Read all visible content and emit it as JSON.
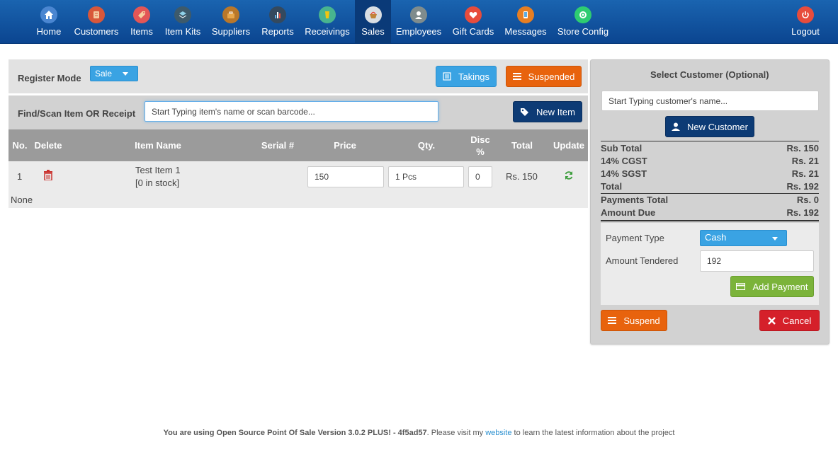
{
  "nav": {
    "items": [
      {
        "label": "Home",
        "icon": "home-icon",
        "color": "#4a86d1"
      },
      {
        "label": "Customers",
        "icon": "customers-icon",
        "color": "#d8573a"
      },
      {
        "label": "Items",
        "icon": "items-icon",
        "color": "#e35656"
      },
      {
        "label": "Item Kits",
        "icon": "item-kits-icon",
        "color": "#3d5a6b"
      },
      {
        "label": "Suppliers",
        "icon": "suppliers-icon",
        "color": "#b9772a"
      },
      {
        "label": "Reports",
        "icon": "reports-icon",
        "color": "#34495e"
      },
      {
        "label": "Receivings",
        "icon": "receivings-icon",
        "color": "#48b48f"
      },
      {
        "label": "Sales",
        "icon": "sales-icon",
        "color": "#f2a23a"
      },
      {
        "label": "Employees",
        "icon": "employees-icon",
        "color": "#7f8c8d"
      },
      {
        "label": "Gift Cards",
        "icon": "gift-cards-icon",
        "color": "#e74c3c"
      },
      {
        "label": "Messages",
        "icon": "messages-icon",
        "color": "#e67e22"
      },
      {
        "label": "Store Config",
        "icon": "store-config-icon",
        "color": "#2ecc71"
      }
    ],
    "logout": {
      "label": "Logout",
      "icon": "power-icon",
      "color": "#e74c3c"
    }
  },
  "register": {
    "mode_label": "Register Mode",
    "mode_value": "Sale",
    "takings_label": "Takings",
    "suspended_label": "Suspended"
  },
  "find": {
    "label": "Find/Scan Item OR Receipt",
    "placeholder": "Start Typing item's name or scan barcode...",
    "new_item_label": "New Item"
  },
  "cart": {
    "headers": {
      "no": "No.",
      "delete": "Delete",
      "item_name": "Item Name",
      "serial": "Serial #",
      "price": "Price",
      "qty": "Qty.",
      "disc": "Disc %",
      "total": "Total",
      "update": "Update"
    },
    "rows": [
      {
        "no": "1",
        "name": "Test Item 1",
        "stock": "[0 in stock]",
        "price": "150",
        "qty": "1 Pcs",
        "disc": "0",
        "total": "Rs. 150"
      }
    ],
    "serial_note": "None"
  },
  "customer": {
    "title": "Select Customer (Optional)",
    "placeholder": "Start Typing customer's name...",
    "new_customer_label": "New Customer"
  },
  "summary": {
    "subtotal_label": "Sub Total",
    "subtotal_value": "Rs. 150",
    "cgst_label": "14% CGST",
    "cgst_value": "Rs. 21",
    "sgst_label": "14% SGST",
    "sgst_value": "Rs. 21",
    "total_label": "Total",
    "total_value": "Rs. 192",
    "payments_total_label": "Payments Total",
    "payments_total_value": "Rs. 0",
    "amount_due_label": "Amount Due",
    "amount_due_value": "Rs. 192"
  },
  "payment": {
    "type_label": "Payment Type",
    "type_value": "Cash",
    "tendered_label": "Amount Tendered",
    "tendered_value": "192",
    "add_payment_label": "Add Payment",
    "suspend_label": "Suspend",
    "cancel_label": "Cancel"
  },
  "footer": {
    "prefix": "You are using Open Source Point Of Sale Version 3.0.2 PLUS! - 4f5ad57",
    "middle": ". Please visit my ",
    "link": "website",
    "suffix": " to learn the latest information about the project"
  }
}
